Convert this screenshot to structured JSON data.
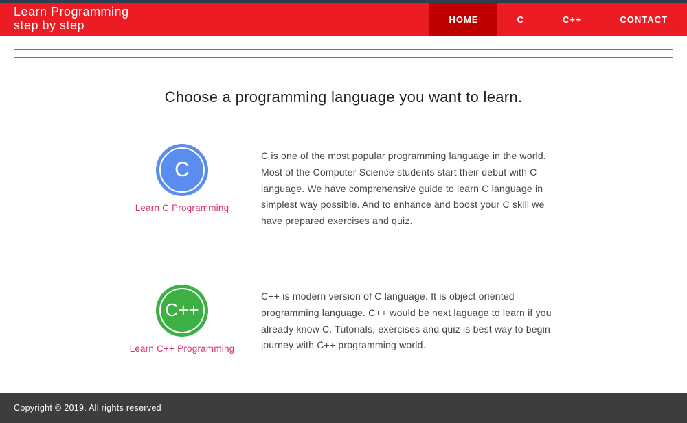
{
  "site": {
    "title_line1": "Learn Programming",
    "title_line2": "step by step"
  },
  "nav": {
    "home": "HOME",
    "c": "C",
    "cpp": "C++",
    "contact": "CONTACT"
  },
  "main": {
    "heading": "Choose a programming language you want to learn."
  },
  "languages": {
    "c": {
      "icon_text": "C",
      "link_label": "Learn C Programming",
      "description": "C is one of the most popular programming language in the world. Most of the Computer Science students start their debut with C language. We have comprehensive guide to learn C language in simplest way possible. And to enhance and boost your C skill we have prepared exercises and quiz."
    },
    "cpp": {
      "icon_text": "C++",
      "link_label": "Learn C++ Programming",
      "description": "C++ is modern version of C language. It is object oriented programming language. C++ would be next laguage to learn if you already know C. Tutorials, exercises and quiz is best way to begin journey with C++ programming world."
    }
  },
  "footer": {
    "copyright": "Copyright © 2019. All rights reserved"
  }
}
